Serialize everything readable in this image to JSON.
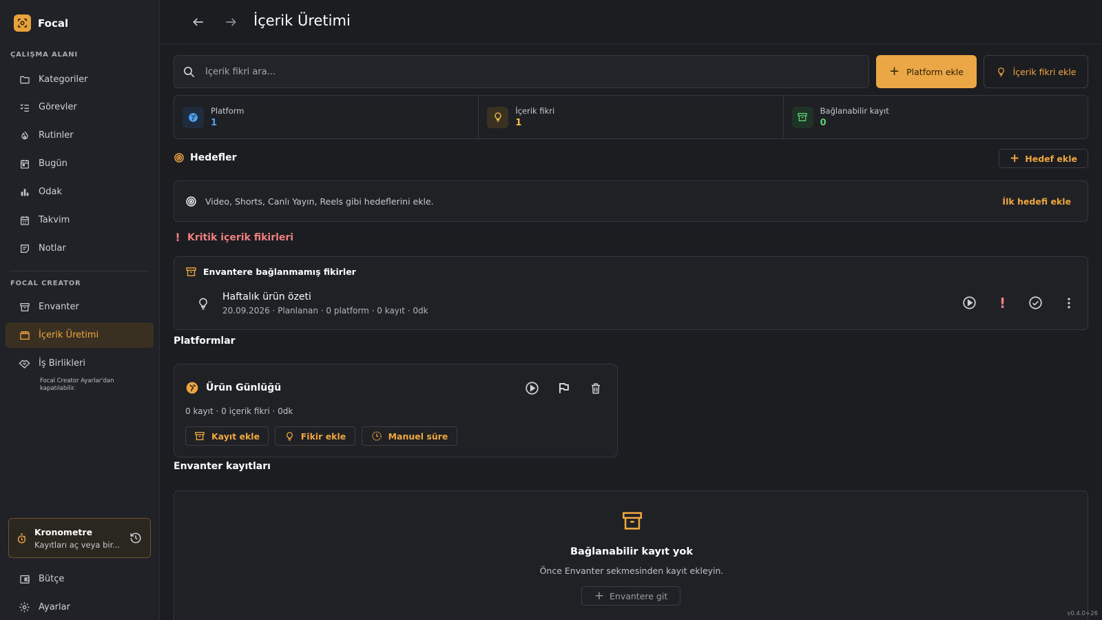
{
  "app": {
    "name": "Focal"
  },
  "sidebar": {
    "section1": "ÇALIŞMA ALANI",
    "items1": [
      {
        "label": "Kategoriler",
        "icon": "folder-icon"
      },
      {
        "label": "Görevler",
        "icon": "checklist-icon"
      },
      {
        "label": "Rutinler",
        "icon": "routine-icon"
      },
      {
        "label": "Bugün",
        "icon": "calendar-day-icon"
      },
      {
        "label": "Odak",
        "icon": "bar-chart-icon"
      },
      {
        "label": "Takvim",
        "icon": "calendar-icon"
      },
      {
        "label": "Notlar",
        "icon": "notes-icon"
      }
    ],
    "section2": "FOCAL CREATOR",
    "items2": [
      {
        "label": "Envanter",
        "icon": "archive-icon"
      },
      {
        "label": "İçerik Üretimi",
        "icon": "clapperboard-icon",
        "active": true
      },
      {
        "label": "İş Birlikleri",
        "icon": "handshake-icon"
      }
    ],
    "note": "Focal Creator Ayarlar'dan kapatılabilir.",
    "stopwatch": {
      "title": "Kronometre",
      "subtitle": "Kayıtları aç veya bir..."
    },
    "bottom": [
      {
        "label": "Bütçe",
        "icon": "wallet-icon"
      },
      {
        "label": "Ayarlar",
        "icon": "gear-icon"
      }
    ]
  },
  "header": {
    "title": "İçerik Üretimi"
  },
  "toolbar": {
    "search_placeholder": "İçerik fikri ara...",
    "add_platform": "Platform ekle",
    "add_idea": "İçerik fikri ekle"
  },
  "stats": [
    {
      "label": "Platform",
      "value": "1",
      "color": "#4ea3f5"
    },
    {
      "label": "İçerik fikri",
      "value": "1",
      "color": "#f2c14e"
    },
    {
      "label": "Bağlanabilir kayıt",
      "value": "0",
      "color": "#5fcf75"
    }
  ],
  "goals": {
    "title": "Hedefler",
    "add_button": "Hedef ekle",
    "hint": "Video, Shorts, Canlı Yayın, Reels gibi hedeflerini ekle.",
    "first_link": "İlk hedefi ekle"
  },
  "critical": {
    "title": "Kritik içerik fikirleri",
    "subtitle": "Envantere bağlanmamış fikirler",
    "idea": {
      "title": "Haftalık ürün özeti",
      "meta": "20.09.2026 · Planlanan · 0 platform · 0 kayıt · 0dk"
    }
  },
  "platforms": {
    "title": "Platformlar",
    "card": {
      "name": "Ürün Günlüğü",
      "meta": "0 kayıt · 0 içerik fikri · 0dk",
      "add_record": "Kayıt ekle",
      "add_idea": "Fikir ekle",
      "manual_time": "Manuel süre"
    }
  },
  "inventory": {
    "title": "Envanter kayıtları",
    "empty_title": "Bağlanabilir kayıt yok",
    "empty_sub": "Önce Envanter sekmesinden kayıt ekleyin.",
    "go_button": "Envantere git"
  },
  "version": "v0.4.0+26",
  "colors": {
    "accent": "#f0a640",
    "danger": "#f07f7f",
    "background": "#1b1d21"
  }
}
